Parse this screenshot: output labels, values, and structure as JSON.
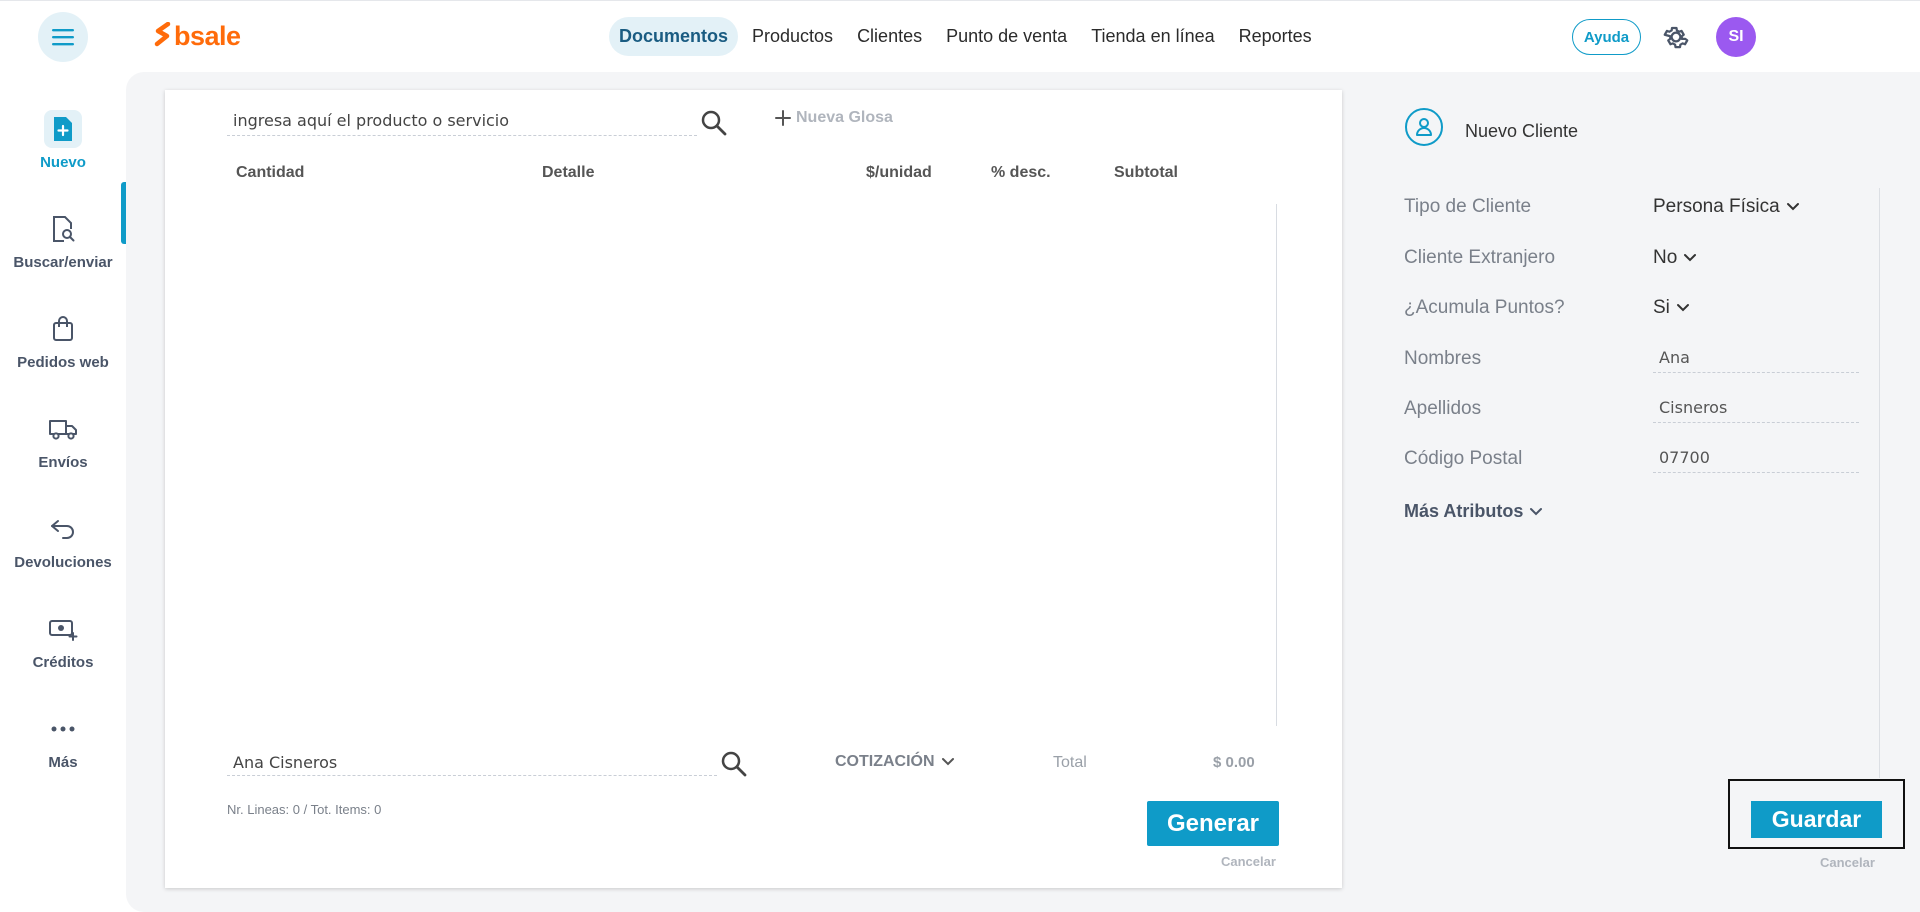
{
  "brand": {
    "name": "bsale"
  },
  "nav": {
    "items": [
      {
        "label": "Documentos",
        "active": true
      },
      {
        "label": "Productos",
        "active": false
      },
      {
        "label": "Clientes",
        "active": false
      },
      {
        "label": "Punto de venta",
        "active": false
      },
      {
        "label": "Tienda en línea",
        "active": false
      },
      {
        "label": "Reportes",
        "active": false
      }
    ],
    "help_label": "Ayuda",
    "avatar_initials": "SI"
  },
  "sidebar": {
    "items": [
      {
        "label": "Nuevo",
        "icon": "file-plus-icon",
        "active": true
      },
      {
        "label": "Buscar/enviar",
        "icon": "file-search-icon"
      },
      {
        "label": "Pedidos web",
        "icon": "shopping-bag-icon"
      },
      {
        "label": "Envíos",
        "icon": "truck-icon"
      },
      {
        "label": "Devoluciones",
        "icon": "return-arrow-icon"
      },
      {
        "label": "Créditos",
        "icon": "cash-plus-icon"
      },
      {
        "label": "Más",
        "icon": "more-dots-icon"
      }
    ]
  },
  "document": {
    "product_search_placeholder": "ingresa aquí el producto o servicio",
    "new_gloss_label": "Nueva Glosa",
    "columns": [
      "Cantidad",
      "Detalle",
      "$/unidad",
      "% desc.",
      "Subtotal"
    ],
    "client_search_value": "Ana Cisneros",
    "doc_type": "COTIZACIÓN",
    "total_label": "Total",
    "total_value": "$ 0.00",
    "summary": "Nr. Lineas: 0 / Tot. Items: 0",
    "generate_label": "Generar",
    "cancel_label": "Cancelar"
  },
  "client_panel": {
    "title": "Nuevo Cliente",
    "fields": {
      "tipo": {
        "label": "Tipo de Cliente",
        "value": "Persona Física"
      },
      "extranjero": {
        "label": "Cliente Extranjero",
        "value": "No"
      },
      "puntos": {
        "label": "¿Acumula Puntos?",
        "value": "Si"
      },
      "nombres": {
        "label": "Nombres",
        "value": "Ana"
      },
      "apellidos": {
        "label": "Apellidos",
        "value": "Cisneros"
      },
      "postal": {
        "label": "Código Postal",
        "value": "07700"
      }
    },
    "more_attributes_label": "Más Atributos",
    "save_label": "Guardar",
    "cancel_label": "Cancelar"
  },
  "colors": {
    "accent": "#0f9bc8",
    "brand_orange": "#ff6b0a",
    "avatar": "#9b59f0"
  }
}
